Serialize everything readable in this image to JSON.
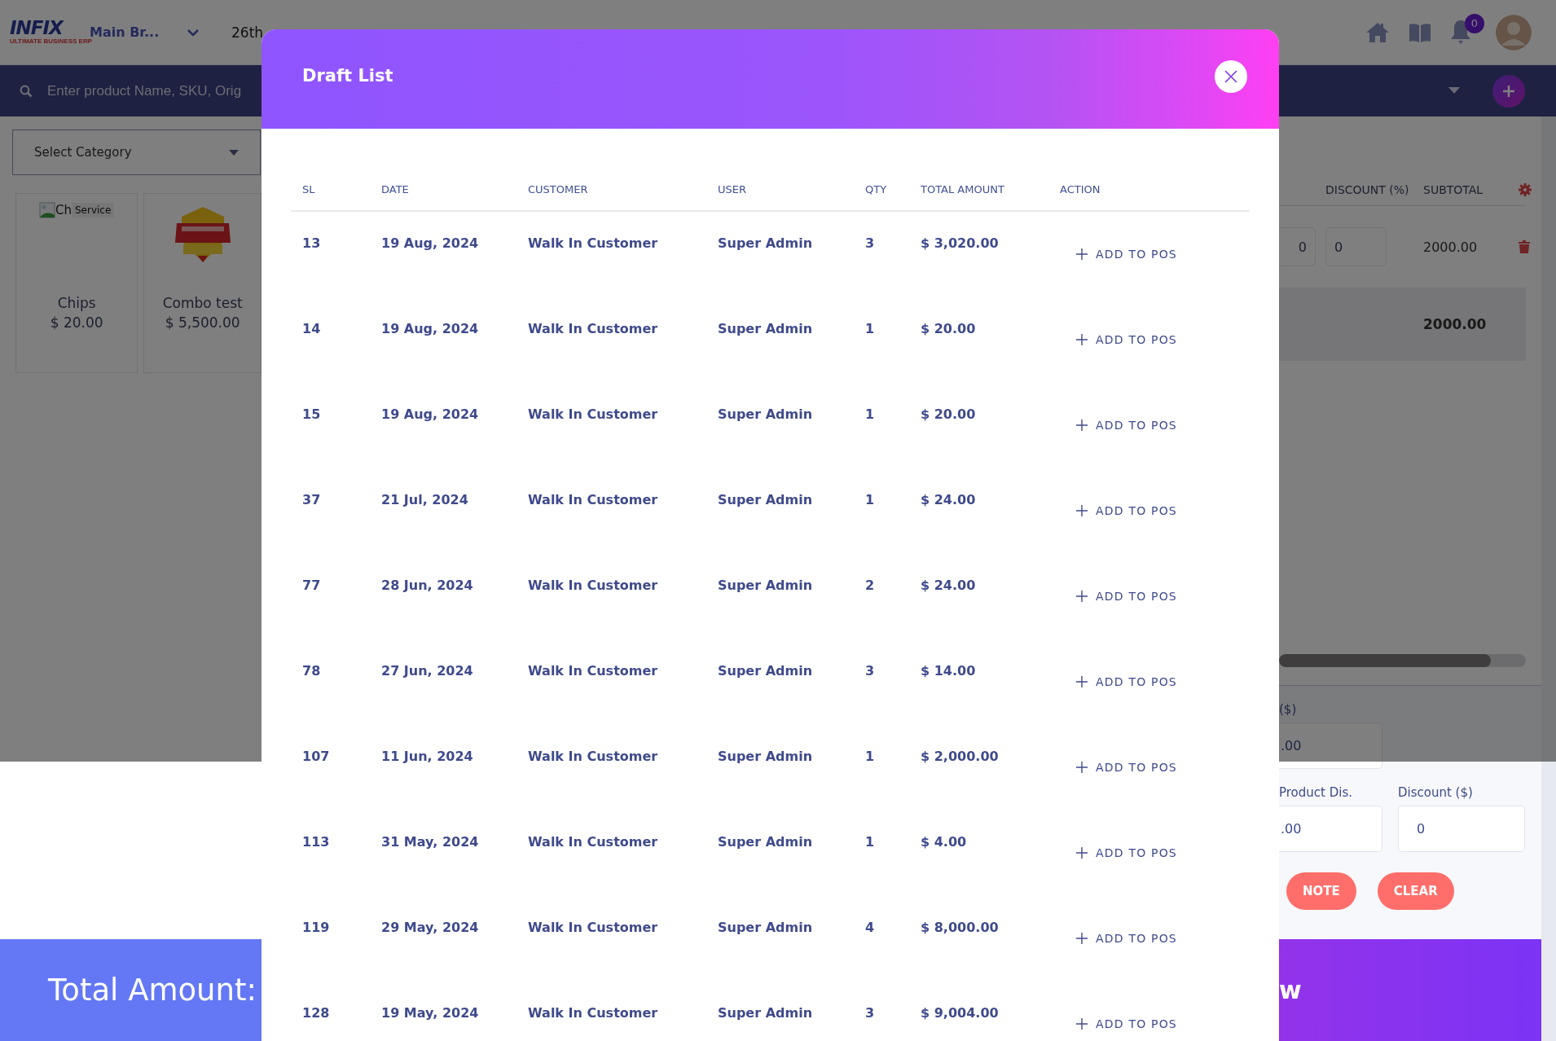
{
  "header": {
    "logo": "INFIX",
    "logo_tagline": "ULTIMATE BUSINESS ERP",
    "branch": "Main Br...",
    "date": "26th",
    "notifications": "0"
  },
  "search": {
    "placeholder": "Enter product Name, SKU, Orig"
  },
  "category_select": {
    "placeholder": "Select Category"
  },
  "products": [
    {
      "kind": "broken-image",
      "image_alt": "Ch",
      "tag": "Service",
      "name": "Chips",
      "price": "$ 20.00"
    },
    {
      "kind": "picture",
      "name": "Combo test",
      "price": "$ 5,500.00"
    }
  ],
  "cart": {
    "columns": [
      "DISCOUNT (%)",
      "SUBTOTAL"
    ],
    "rows": [
      {
        "column_1": "0",
        "discount": "0",
        "subtotal": "2000.00"
      }
    ],
    "total": "2000.00"
  },
  "summary": {
    "fields": [
      {
        "label": "($)",
        "value": ".00"
      },
      {
        "label": "Product Dis.",
        "value": ".00"
      },
      {
        "label": "Discount ($)",
        "value": "0"
      }
    ],
    "buttons": [
      "NOTE",
      "CLEAR"
    ]
  },
  "footer": {
    "total_label": "Total Amount:",
    "action_label": "w"
  },
  "modal": {
    "title": "Draft List",
    "columns": [
      "SL",
      "DATE",
      "CUSTOMER",
      "USER",
      "QTY",
      "TOTAL AMOUNT",
      "ACTION"
    ],
    "rows": [
      {
        "sl": "13",
        "date": "19 Aug, 2024",
        "customer": "Walk In Customer",
        "user": "Super Admin",
        "qty": "3",
        "total": "$ 3,020.00",
        "action": "ADD TO POS"
      },
      {
        "sl": "14",
        "date": "19 Aug, 2024",
        "customer": "Walk In Customer",
        "user": "Super Admin",
        "qty": "1",
        "total": "$ 20.00",
        "action": "ADD TO POS"
      },
      {
        "sl": "15",
        "date": "19 Aug, 2024",
        "customer": "Walk In Customer",
        "user": "Super Admin",
        "qty": "1",
        "total": "$ 20.00",
        "action": "ADD TO POS"
      },
      {
        "sl": "37",
        "date": "21 Jul, 2024",
        "customer": "Walk In Customer",
        "user": "Super Admin",
        "qty": "1",
        "total": "$ 24.00",
        "action": "ADD TO POS"
      },
      {
        "sl": "77",
        "date": "28 Jun, 2024",
        "customer": "Walk In Customer",
        "user": "Super Admin",
        "qty": "2",
        "total": "$ 24.00",
        "action": "ADD TO POS"
      },
      {
        "sl": "78",
        "date": "27 Jun, 2024",
        "customer": "Walk In Customer",
        "user": "Super Admin",
        "qty": "3",
        "total": "$ 14.00",
        "action": "ADD TO POS"
      },
      {
        "sl": "107",
        "date": "11 Jun, 2024",
        "customer": "Walk In Customer",
        "user": "Super Admin",
        "qty": "1",
        "total": "$ 2,000.00",
        "action": "ADD TO POS"
      },
      {
        "sl": "113",
        "date": "31 May, 2024",
        "customer": "Walk In Customer",
        "user": "Super Admin",
        "qty": "1",
        "total": "$ 4.00",
        "action": "ADD TO POS"
      },
      {
        "sl": "119",
        "date": "29 May, 2024",
        "customer": "Walk In Customer",
        "user": "Super Admin",
        "qty": "4",
        "total": "$ 8,000.00",
        "action": "ADD TO POS"
      },
      {
        "sl": "128",
        "date": "19 May, 2024",
        "customer": "Walk In Customer",
        "user": "Super Admin",
        "qty": "3",
        "total": "$ 9,004.00",
        "action": "ADD TO POS"
      }
    ]
  }
}
